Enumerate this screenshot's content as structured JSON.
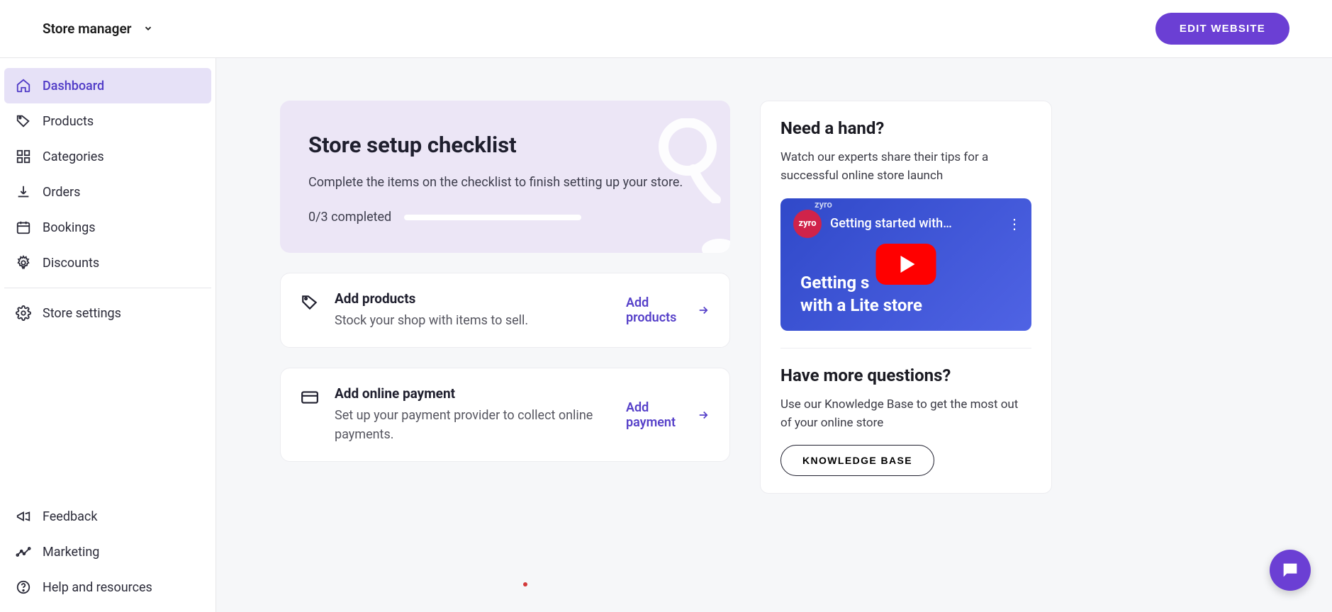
{
  "header": {
    "selector_label": "Store manager",
    "edit_button": "EDIT WEBSITE"
  },
  "sidebar": {
    "primary": [
      {
        "label": "Dashboard"
      },
      {
        "label": "Products"
      },
      {
        "label": "Categories"
      },
      {
        "label": "Orders"
      },
      {
        "label": "Bookings"
      },
      {
        "label": "Discounts"
      }
    ],
    "settings": {
      "label": "Store settings"
    },
    "footer": [
      {
        "label": "Feedback"
      },
      {
        "label": "Marketing"
      },
      {
        "label": "Help and resources"
      }
    ]
  },
  "checklist": {
    "title": "Store setup checklist",
    "subtitle": "Complete the items on the checklist to finish setting up your store.",
    "progress_text": "0/3 completed",
    "tasks": [
      {
        "title": "Add products",
        "desc": "Stock your shop with items to sell.",
        "action": "Add products"
      },
      {
        "title": "Add online payment",
        "desc": "Set up your payment provider to collect online payments.",
        "action": "Add payment"
      }
    ]
  },
  "help": {
    "title": "Need a hand?",
    "desc": "Watch our experts share their tips for a successful online store launch",
    "video_brand": "zyro",
    "video_title_small": "Getting started with…",
    "video_overlay_line1": "Getting s",
    "video_overlay_line2": "with a Lite store",
    "questions_title": "Have more questions?",
    "questions_desc": "Use our Knowledge Base to get the most out of your online store",
    "kb_button": "KNOWLEDGE BASE"
  }
}
